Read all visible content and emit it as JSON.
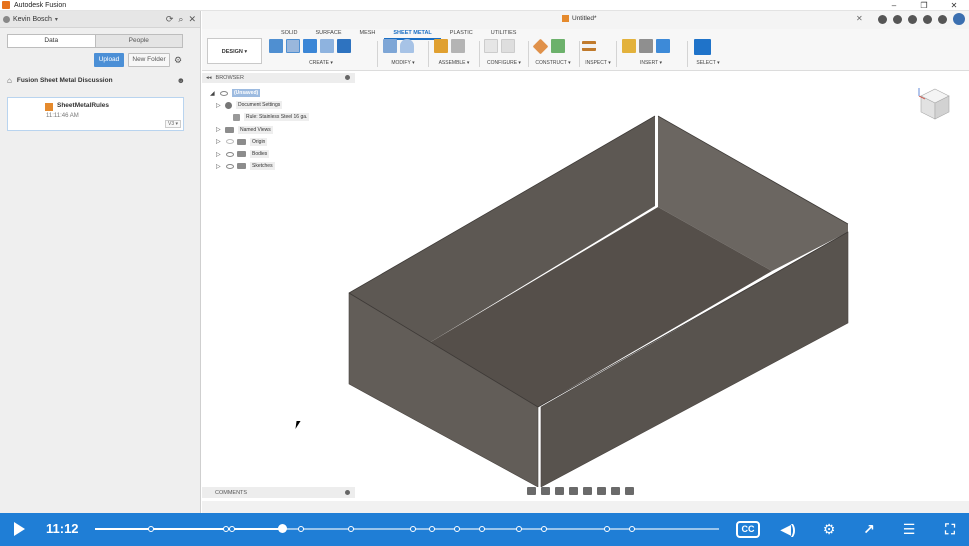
{
  "window": {
    "title": "Autodesk Fusion",
    "minimize": "–",
    "maximize": "❐",
    "close": "✕"
  },
  "data_panel": {
    "user_name": "Kevin Bosch",
    "tabs": [
      "Data",
      "People"
    ],
    "upload_label": "Upload",
    "new_folder_label": "New Folder",
    "breadcrumb": "Fusion Sheet Metal Discussion",
    "file": {
      "name": "SheetMetalRules",
      "time": "11:11:46 AM",
      "version": "V3 ▾"
    }
  },
  "document": {
    "tab_name": "Untitled*",
    "close_label": "✕"
  },
  "ribbon": {
    "tabs": [
      "SOLID",
      "SURFACE",
      "MESH",
      "SHEET METAL",
      "PLASTIC",
      "UTILITIES"
    ],
    "active_tab": "SHEET METAL",
    "design_label": "DESIGN ▾",
    "groups": [
      "CREATE ▾",
      "MODIFY ▾",
      "ASSEMBLE ▾",
      "CONFIGURE ▾",
      "CONSTRUCT ▾",
      "INSPECT ▾",
      "INSERT ▾",
      "SELECT ▾"
    ]
  },
  "browser": {
    "title": "BROWSER",
    "collapse": "◂◂",
    "items": [
      {
        "label": "(Unsaved)",
        "type": "root"
      },
      {
        "label": "Document Settings",
        "type": "settings"
      },
      {
        "label": "Rule: Stainless Steel 16 ga.",
        "type": "rule"
      },
      {
        "label": "Named Views",
        "type": "folder"
      },
      {
        "label": "Origin",
        "type": "folder"
      },
      {
        "label": "Bodies",
        "type": "folder"
      },
      {
        "label": "Sketches",
        "type": "folder"
      }
    ]
  },
  "comments": {
    "title": "COMMENTS"
  },
  "player": {
    "time": "11:12",
    "progress": 0.3,
    "cc_label": "CC",
    "chapters": [
      0.09,
      0.21,
      0.22,
      0.33,
      0.41,
      0.51,
      0.54,
      0.58,
      0.62,
      0.68,
      0.72,
      0.82,
      0.86
    ]
  },
  "colors": {
    "accent": "#1b6fc4",
    "player": "#1f7ed6",
    "model": "#5e5953"
  }
}
